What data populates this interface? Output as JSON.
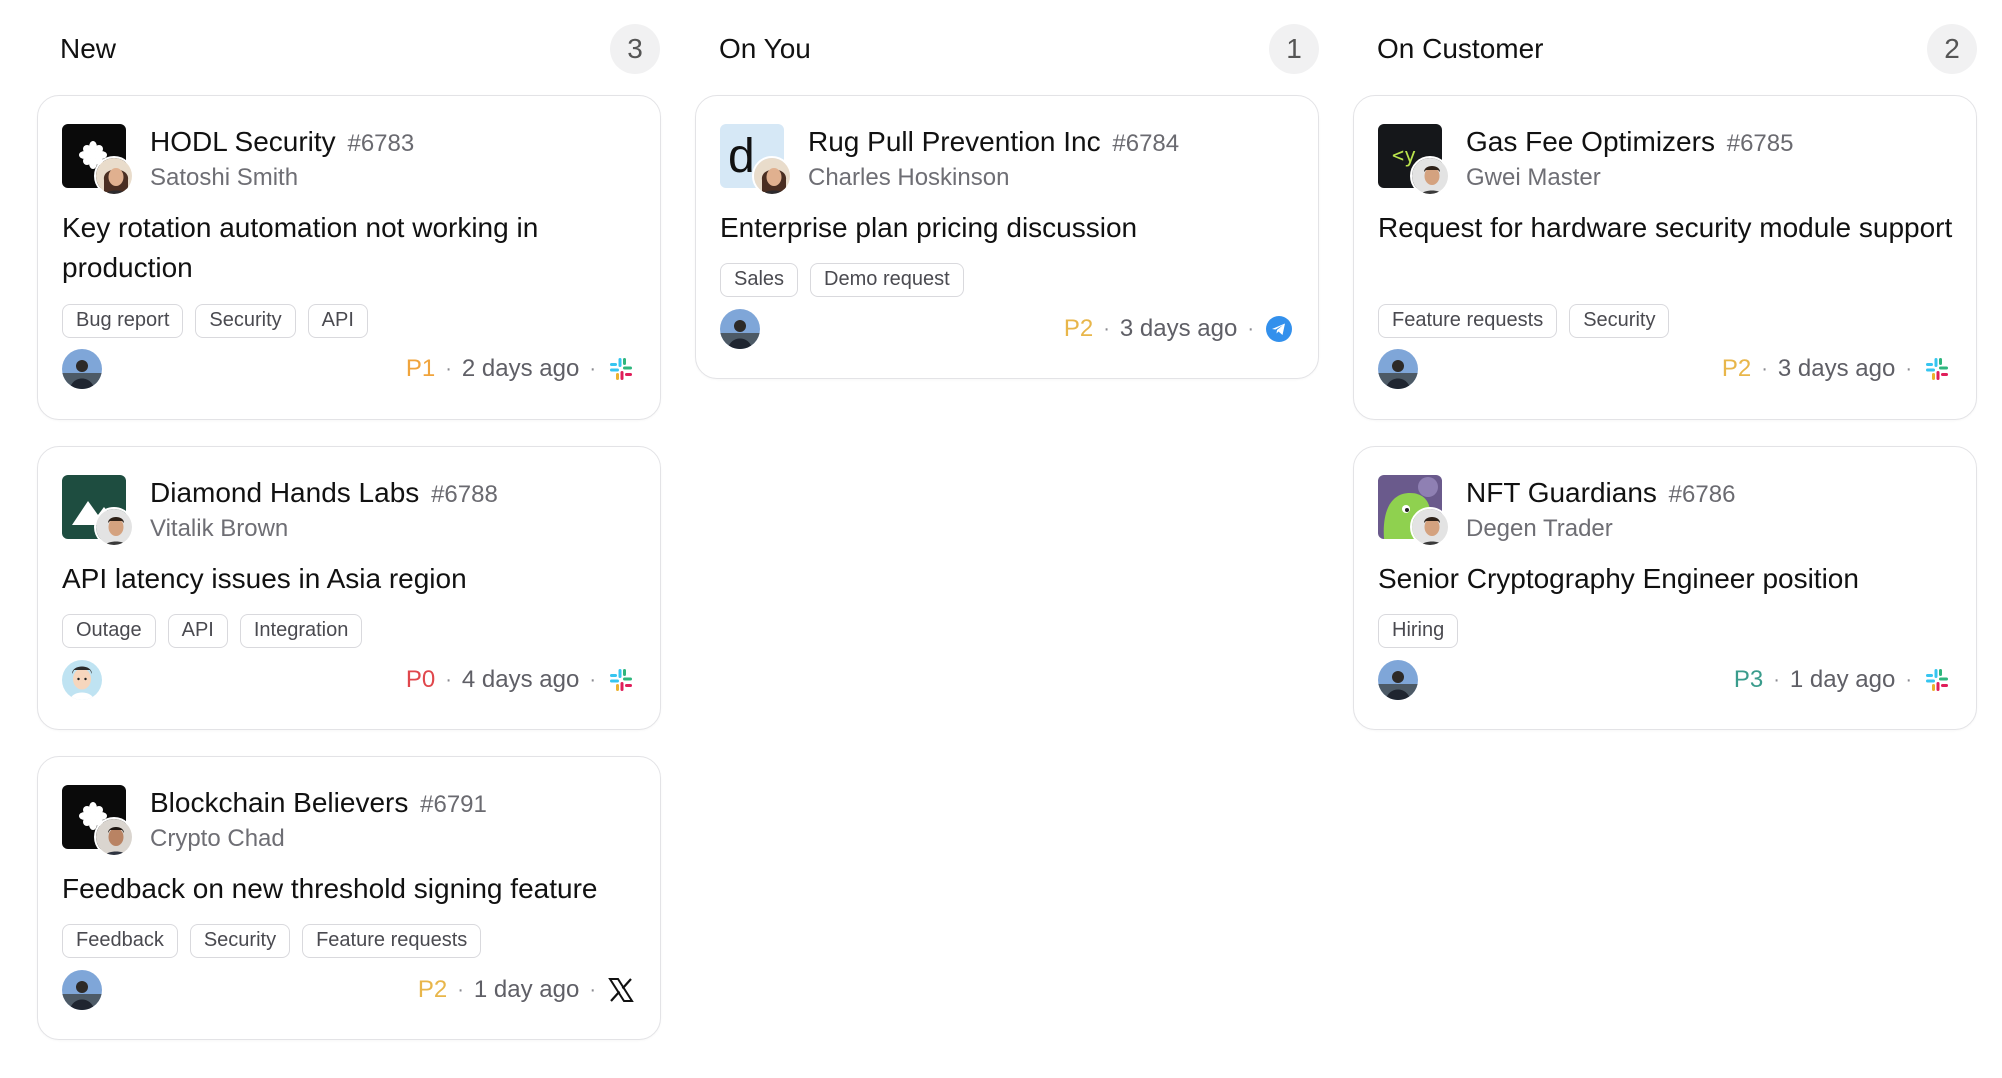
{
  "columns": [
    {
      "title": "New",
      "count": "3"
    },
    {
      "title": "On You",
      "count": "1"
    },
    {
      "title": "On Customer",
      "count": "2"
    }
  ],
  "priority_colors": {
    "P0": "#e0474c",
    "P1": "#f0a43c",
    "P2": "#e8b64a",
    "P3": "#3a9c8c"
  },
  "cards": [
    {
      "column": 0,
      "company": "HODL Security",
      "id": "#6783",
      "contact": "Satoshi Smith",
      "subject": "Key rotation automation not working in production",
      "tags": [
        "Bug report",
        "Security",
        "API"
      ],
      "priority": "P1",
      "age": "2 days ago",
      "source_icon": "slack-icon",
      "logo_icon": "asterisk-logo-icon",
      "contact_avatar": "woman-avatar",
      "assignee_avatar": "photo-avatar"
    },
    {
      "column": 0,
      "company": "Diamond Hands Labs",
      "id": "#6788",
      "contact": "Vitalik Brown",
      "subject": "API latency issues in Asia region",
      "tags": [
        "Outage",
        "API",
        "Integration"
      ],
      "priority": "P0",
      "age": "4 days ago",
      "source_icon": "slack-icon",
      "logo_icon": "mountain-logo-icon",
      "contact_avatar": "man-avatar",
      "assignee_avatar": "cartoon-avatar"
    },
    {
      "column": 0,
      "company": "Blockchain Believers",
      "id": "#6791",
      "contact": "Crypto Chad",
      "subject": "Feedback on new threshold signing feature",
      "tags": [
        "Feedback",
        "Security",
        "Feature requests"
      ],
      "priority": "P2",
      "age": "1 day ago",
      "source_icon": "x-icon",
      "logo_icon": "asterisk-logo-icon",
      "contact_avatar": "man-avatar",
      "assignee_avatar": "photo-avatar"
    },
    {
      "column": 1,
      "company": "Rug Pull Prevention Inc",
      "id": "#6784",
      "contact": "Charles Hoskinson",
      "subject": "Enterprise plan pricing discussion",
      "tags": [
        "Sales",
        "Demo request"
      ],
      "priority": "P2",
      "age": "3 days ago",
      "source_icon": "telegram-icon",
      "logo_icon": "letter-d-logo-icon",
      "contact_avatar": "woman-avatar",
      "assignee_avatar": "photo-avatar"
    },
    {
      "column": 2,
      "company": "Gas Fee Optimizers",
      "id": "#6785",
      "contact": "Gwei Master",
      "subject": "Request for hardware security module support",
      "tags": [
        "Feature requests",
        "Security"
      ],
      "priority": "P2",
      "age": "3 days ago",
      "source_icon": "slack-icon",
      "logo_icon": "code-logo-icon",
      "contact_avatar": "man-avatar",
      "assignee_avatar": "photo-avatar"
    },
    {
      "column": 2,
      "company": "NFT Guardians",
      "id": "#6786",
      "contact": "Degen Trader",
      "subject": "Senior Cryptography Engineer position",
      "tags": [
        "Hiring"
      ],
      "priority": "P3",
      "age": "1 day ago",
      "source_icon": "slack-icon",
      "logo_icon": "dino-logo-icon",
      "contact_avatar": "man-avatar",
      "assignee_avatar": "photo-avatar"
    }
  ]
}
